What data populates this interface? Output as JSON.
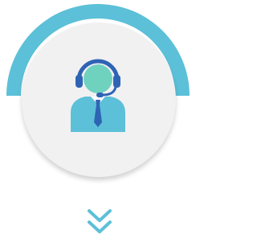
{
  "colors": {
    "accent": "#5cc0d8",
    "disc": "#f1f1f2",
    "headset": "#2f64b4",
    "face": "#6fd2bf",
    "body": "#5cc0d8",
    "tie": "#2f64b4"
  },
  "icons": {
    "main": "customer-service-agent-icon",
    "scroll": "double-chevron-down-icon"
  }
}
